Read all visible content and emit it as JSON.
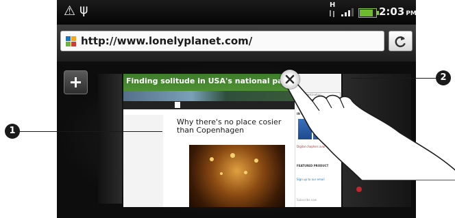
{
  "status_bar": {
    "time": "2:03",
    "ampm": "PM",
    "network_label": "H",
    "battery_color": "#6dbb2f",
    "icons": [
      "warning-icon",
      "usb-icon",
      "data-arrows-icon",
      "signal-icon",
      "battery-icon"
    ]
  },
  "browser": {
    "url": "http://www.lonelyplanet.com/",
    "refresh_icon": "refresh-icon",
    "new_tab_icon": "plus-icon",
    "close_tab_icon": "close-icon"
  },
  "page_thumbnail": {
    "banner_title": "Finding solitude in USA's national parks",
    "headline": "Why there's no place cosier than Copenhagen",
    "shop_heading": "IN OUR SHOP",
    "shop_link": "Digital chapters avai",
    "featured_heading": "FEATURED PRODUCT",
    "signup": "Sign up to our email",
    "subscribe": "Subscribe now",
    "find_placeholder": "Find a destination..."
  },
  "callouts": [
    {
      "number": "1"
    },
    {
      "number": "2"
    }
  ]
}
